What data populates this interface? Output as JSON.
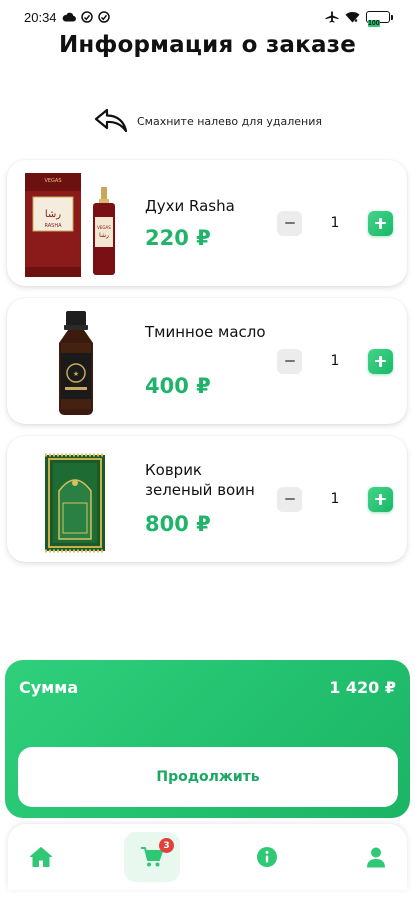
{
  "status_bar": {
    "time": "20:34",
    "battery_level": "100"
  },
  "header": {
    "title": "Информация о заказе"
  },
  "hint": {
    "text": "Смахните налево для удаления",
    "icon": "swipe-back-arrow-icon"
  },
  "order_items": [
    {
      "name": "Духи Rasha",
      "price": "220 ₽",
      "quantity": "1",
      "image": "rasha-perfume-box-and-bottle"
    },
    {
      "name": "Тминное масло",
      "price": "400 ₽",
      "quantity": "1",
      "image": "black-seed-oil-bottle"
    },
    {
      "name": "Коврик зеленый воин",
      "price": "800 ₽",
      "quantity": "1",
      "image": "green-prayer-rug"
    }
  ],
  "summary": {
    "label": "Сумма",
    "total": "1 420 ₽",
    "continue_label": "Продолжить"
  },
  "bottom_nav": {
    "items": [
      {
        "name": "home",
        "icon": "home-icon"
      },
      {
        "name": "cart",
        "icon": "cart-icon",
        "badge": "3",
        "active": true
      },
      {
        "name": "info",
        "icon": "info-icon"
      },
      {
        "name": "profile",
        "icon": "user-icon"
      }
    ]
  },
  "colors": {
    "accent": "#20b46a",
    "panel": "#2bc874",
    "minus_bg": "#ececec",
    "badge": "#e0413a",
    "nav_icon": "#2fc874"
  }
}
